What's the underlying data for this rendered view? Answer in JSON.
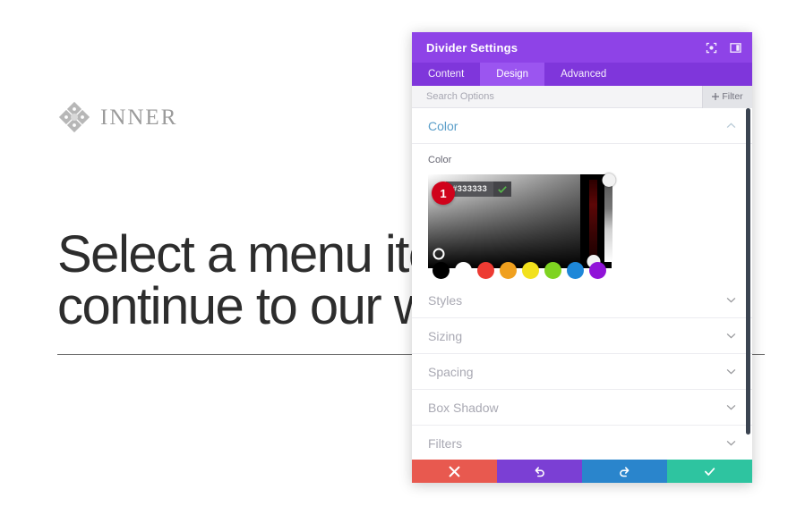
{
  "website": {
    "logo": {
      "icon": "diamond-cluster-logo-icon",
      "text": "INNER"
    },
    "heading": "Select a menu item to\ncontinue to our website",
    "divider_present": true
  },
  "modal": {
    "title": "Divider Settings",
    "header_icons": [
      {
        "name": "focus-target-icon"
      },
      {
        "name": "panel-layout-icon"
      }
    ],
    "tabs": [
      {
        "label": "Content",
        "active": false
      },
      {
        "label": "Design",
        "active": true
      },
      {
        "label": "Advanced",
        "active": false
      }
    ],
    "search": {
      "placeholder": "Search Options",
      "value": ""
    },
    "filter_button": {
      "label": "Filter",
      "icon": "plus-icon"
    },
    "sections": [
      {
        "label": "Color",
        "open": true
      },
      {
        "label": "Styles",
        "open": false
      },
      {
        "label": "Sizing",
        "open": false
      },
      {
        "label": "Spacing",
        "open": false
      },
      {
        "label": "Box Shadow",
        "open": false
      },
      {
        "label": "Filters",
        "open": false
      }
    ],
    "color_section": {
      "field_label": "Color",
      "hex_value": "#333333",
      "confirm_icon": "check-icon",
      "step_badge": "1",
      "swatches": [
        "#000000",
        "#ffffff",
        "#ed3b33",
        "#f0a01e",
        "#f2e11c",
        "#7ed321",
        "#1e87d8",
        "#9013d8"
      ],
      "hue_handle_position": "bottom",
      "alpha_handle_position": "top"
    },
    "action_buttons": [
      {
        "name": "cancel-button",
        "icon": "close-icon",
        "color": "#E8594F"
      },
      {
        "name": "undo-button",
        "icon": "undo-icon",
        "color": "#7B3FD4"
      },
      {
        "name": "redo-button",
        "icon": "redo-icon",
        "color": "#2A85CC"
      },
      {
        "name": "save-button",
        "icon": "check-icon",
        "color": "#2EC4A0"
      }
    ]
  }
}
